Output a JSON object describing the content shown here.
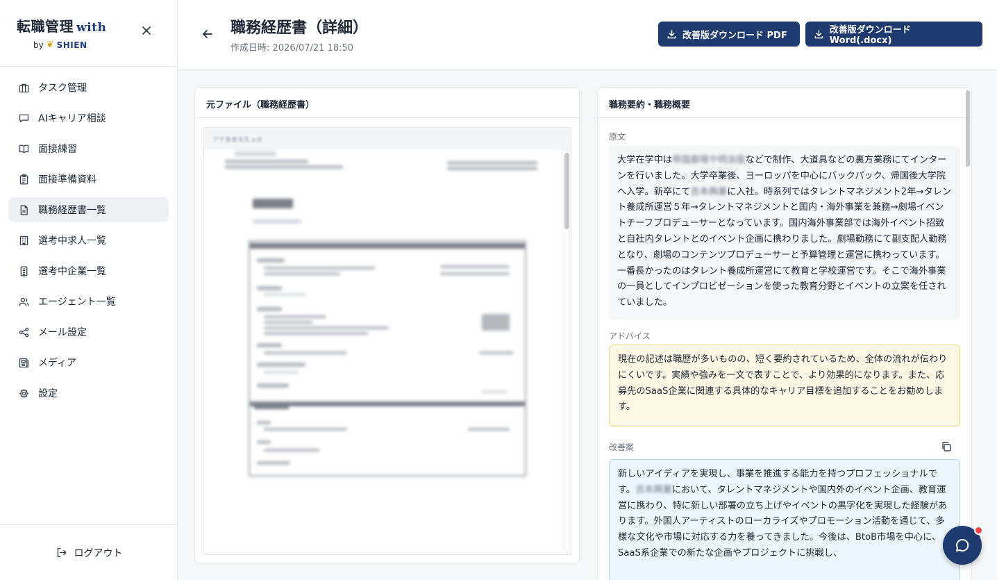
{
  "brand": {
    "title": "転職管理",
    "with": "with",
    "by": "by",
    "shien": "SHIEN"
  },
  "sidebar": {
    "items": [
      {
        "label": "タスク管理",
        "icon": "briefcase-icon"
      },
      {
        "label": "AIキャリア相談",
        "icon": "chat-bubble-icon"
      },
      {
        "label": "面接練習",
        "icon": "book-open-icon"
      },
      {
        "label": "面接準備資料",
        "icon": "clipboard-icon"
      },
      {
        "label": "職務経歴書一覧",
        "icon": "document-icon"
      },
      {
        "label": "選考中求人一覧",
        "icon": "building-icon"
      },
      {
        "label": "選考中企業一覧",
        "icon": "office-icon"
      },
      {
        "label": "エージェント一覧",
        "icon": "users-icon"
      },
      {
        "label": "メール設定",
        "icon": "share-icon"
      },
      {
        "label": "メディア",
        "icon": "newspaper-icon"
      },
      {
        "label": "設定",
        "icon": "gear-icon"
      }
    ],
    "active_index": 4,
    "logout_label": "ログアウト"
  },
  "header": {
    "title": "職務経歴書（詳細）",
    "created": "作成日時: 2026/07/21 18:50",
    "download_pdf": "改善版ダウンロード PDF",
    "download_word": "改善版ダウンロード Word(.docx)"
  },
  "source_card": {
    "title": "元ファイル（職務経歴書）",
    "filename": "ア千身者宋先.pdf"
  },
  "summary_card": {
    "title": "職務要約・職務概要",
    "original_label": "原文",
    "original_parts": [
      "大学在学中は",
      "帝国劇場や明治座",
      "などで制作、大道具などの裏方業務にてインターンを行いました。大学卒業後、ヨーロッパを中心にバックパック、帰国後大学院へ入学。新卒にて",
      "吉本興業",
      "に入社。時系列ではタレントマネジメント2年→タレント養成所運営５年→タレントマネジメントと国内・海外事業を兼務→劇場イベントチーフプロデューサーとなっています。国内海外事業部では海外イベント招致と自社内タレントとのイベント企画に携わりました。劇場勤務にて副支配人勤務となり、劇場のコンテンツプロデューサーと予算管理と運営に携わっています。一番長かったのはタレント養成所運営にて教育と学校運営です。そこで海外事業の一員としてインプロビゼーションを使った教育分野とイベントの立案を任されていました。"
    ],
    "advice_label": "アドバイス",
    "advice_text": "現在の記述は職歴が多いものの、短く要約されているため、全体の流れが伝わりにくいです。実績や強みを一文で表すことで、より効果的になります。また、応募先のSaaS企業に関連する具体的なキャリア目標を追加することをお勧めします。",
    "improve_label": "改善案",
    "improve_parts": [
      "新しいアイディアを実現し、事業を推進する能力を持つプロフェッショナルです。",
      "吉本興業",
      "において、タレントマネジメントや国内外のイベント企画、教育運営に携わり、特に新しい部署の立ち上げやイベントの黒字化を実現した経験があります。外国人アーティストのローカライズやプロモーション活動を通じて、多様な文化や市場に対応する力を養ってきました。今後は、BtoB市場を中心に、SaaS系企業での新たな企画やプロジェクトに挑戦し、"
    ]
  },
  "colors": {
    "primary": "#1e3a6e",
    "advice_bg": "#fdf8e3",
    "improve_bg": "#eef6fd",
    "notification": "#ef4444"
  }
}
